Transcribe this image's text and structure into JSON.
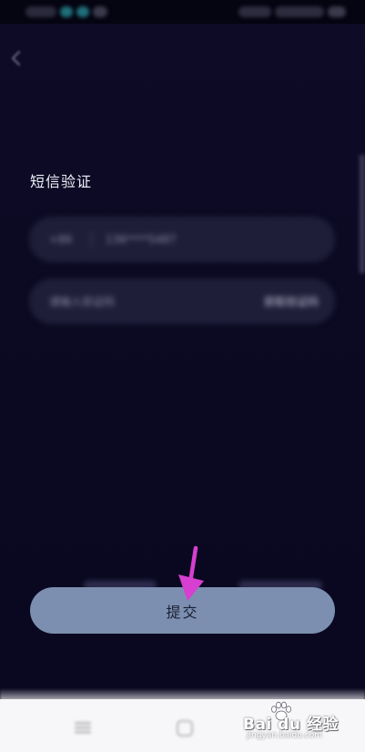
{
  "status_bar": {},
  "header": {
    "title": "短信验证"
  },
  "form": {
    "phone_field": {
      "prefix": "+86",
      "value": "136****5487"
    },
    "code_field": {
      "placeholder": "请输入验证码",
      "get_code_label": "获取验证码"
    }
  },
  "actions": {
    "submit_label": "提交"
  },
  "annotation": {
    "arrow_color": "#d63fd0"
  },
  "watermark": {
    "brand": "Bai du 经验",
    "url": "jingyan.baidu.com"
  },
  "colors": {
    "background": "#0c0a24",
    "button": "#7c8fb0",
    "title_text": "#eef0fa"
  }
}
